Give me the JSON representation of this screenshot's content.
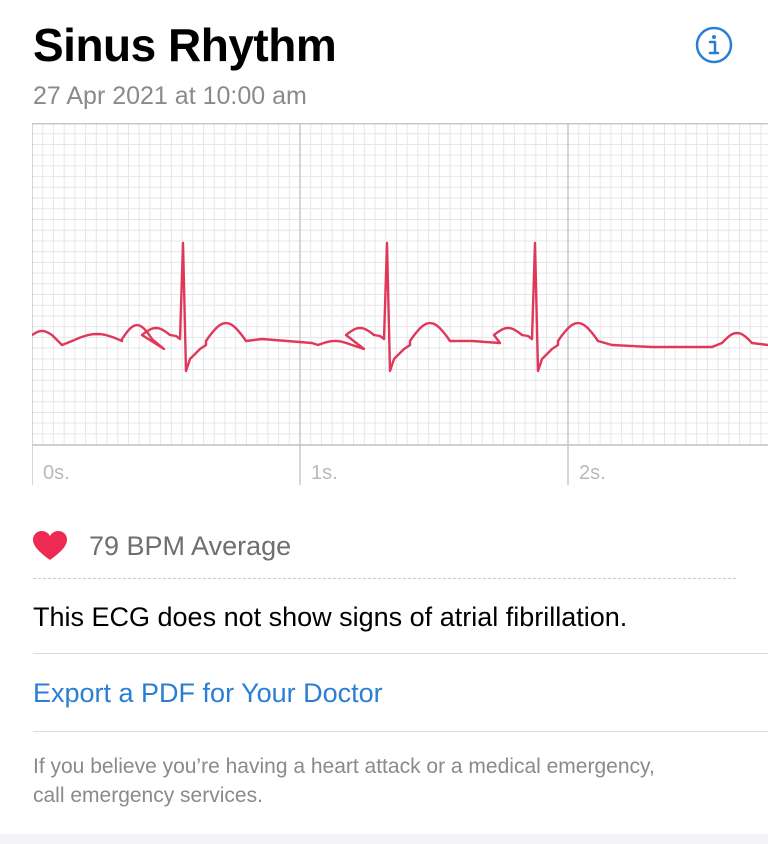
{
  "header": {
    "title": "Sinus Rhythm",
    "timestamp": "27 Apr 2021 at 10:00 am",
    "info_icon": "info-circle-icon"
  },
  "ecg": {
    "time_labels": [
      "0s.",
      "1s.",
      "2s."
    ],
    "trace_color": "#e0385a",
    "grid_color_minor": "#e6e6e9",
    "grid_color_major": "#c4c4c8"
  },
  "summary": {
    "heart_icon": "heart-icon",
    "heart_color": "#ee2a53",
    "bpm_text": "79 BPM Average",
    "result_text": "This ECG does not show signs of atrial fibrillation."
  },
  "actions": {
    "export_label": "Export a PDF for Your Doctor",
    "link_color": "#2a7ed3"
  },
  "footer": {
    "note": "If you believe you’re having a heart attack or a medical emergency, call emergency services."
  }
}
